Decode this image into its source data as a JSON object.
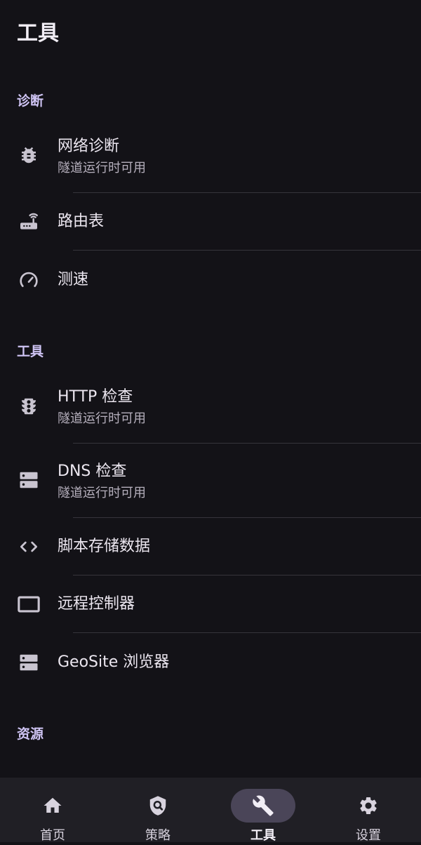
{
  "header": {
    "title": "工具"
  },
  "sections": {
    "diagnostics": {
      "header": "诊断",
      "items": [
        {
          "title": "网络诊断",
          "subtitle": "隧道运行时可用",
          "icon": "bug-icon"
        },
        {
          "title": "路由表",
          "icon": "router-icon"
        },
        {
          "title": "测速",
          "icon": "speed-gauge-icon"
        }
      ]
    },
    "tools": {
      "header": "工具",
      "items": [
        {
          "title": "HTTP 检查",
          "subtitle": "隧道运行时可用",
          "icon": "traffic-light-icon"
        },
        {
          "title": "DNS 检查",
          "subtitle": "隧道运行时可用",
          "icon": "dns-server-icon"
        },
        {
          "title": "脚本存储数据",
          "icon": "code-brackets-icon"
        },
        {
          "title": "远程控制器",
          "icon": "tablet-icon"
        },
        {
          "title": "GeoSite 浏览器",
          "icon": "storage-icon"
        }
      ]
    },
    "resources": {
      "header": "资源"
    }
  },
  "bottom_nav": {
    "items": [
      {
        "label": "首页",
        "icon": "home-icon",
        "active": false
      },
      {
        "label": "策略",
        "icon": "policy-shield-icon",
        "active": false
      },
      {
        "label": "工具",
        "icon": "wrench-icon",
        "active": true
      },
      {
        "label": "设置",
        "icon": "gear-icon",
        "active": false
      }
    ]
  },
  "colors": {
    "background": "#131217",
    "section_header": "#CFC4F4",
    "nav_background": "#201F25",
    "nav_active_pill": "#4A4558"
  }
}
